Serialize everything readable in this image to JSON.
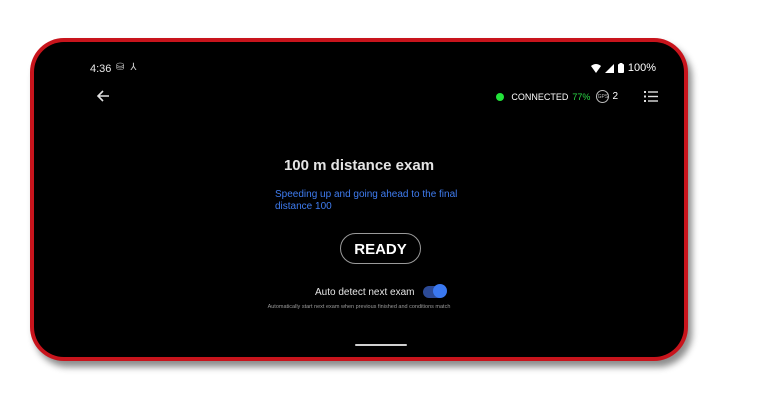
{
  "status_bar": {
    "time": "4:36",
    "left_icons": [
      "sim-icon",
      "network-share-icon"
    ],
    "battery": "100%"
  },
  "header": {
    "back_icon": "arrow-left-icon",
    "connection_status": "CONNECTED",
    "connection_percent": "77%",
    "satellite_icon": "gps-icon",
    "satellite_count": "2",
    "menu_icon": "list-icon"
  },
  "exam": {
    "title": "100 m distance exam",
    "description_line1": "Speeding up and going ahead to the final",
    "description_line2": "distance 100",
    "ready_label": "READY"
  },
  "auto_detect": {
    "label": "Auto detect next exam",
    "enabled": true,
    "hint": "Automatically start next exam when previous finished and conditions match"
  },
  "colors": {
    "frame": "#c8141c",
    "connected_dot": "#22e33a",
    "description": "#3f7cf0",
    "toggle": "#3a78f0"
  }
}
